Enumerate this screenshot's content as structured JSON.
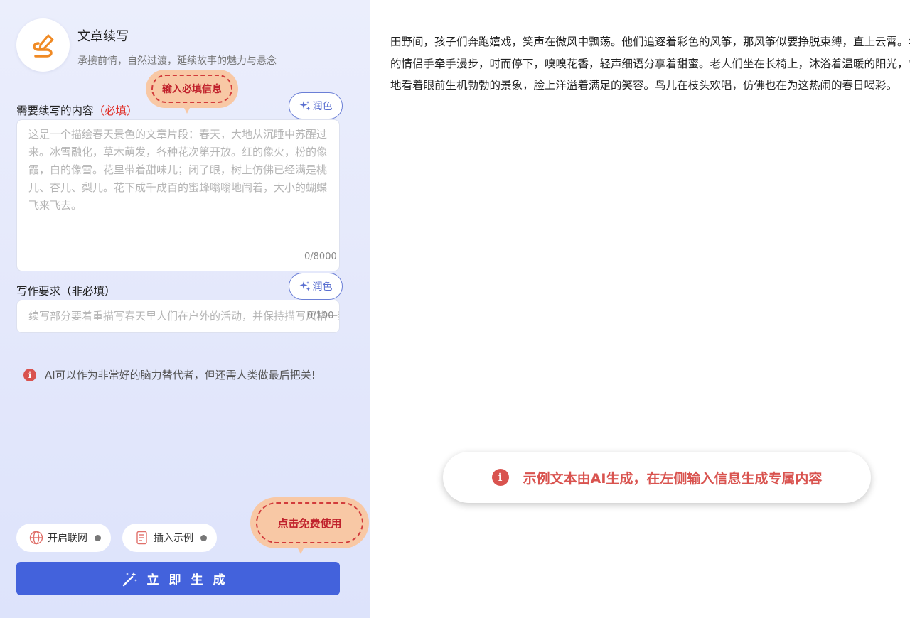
{
  "header": {
    "title": "文章续写",
    "subtitle": "承接前情，自然过渡，延续故事的魅力与悬念"
  },
  "content_field": {
    "label": "需要续写的内容",
    "required_tag": "（必填）",
    "placeholder": "这是一个描绘春天景色的文章片段：春天，大地从沉睡中苏醒过来。冰雪融化，草木萌发，各种花次第开放。红的像火，粉的像霞，白的像雪。花里带着甜味儿；闭了眼，树上仿佛已经满是桃儿、杏儿、梨儿。花下成千成百的蜜蜂嗡嗡地闹着，大小的蝴蝶飞来飞去。",
    "counter": "0/8000",
    "polish_label": "润色"
  },
  "requirement_field": {
    "label": "写作要求（非必填）",
    "placeholder": "续写部分要着重描写春天里人们在户外的活动，并保持描写风格一致",
    "counter": "0/100",
    "polish_label": "润色"
  },
  "tip": "AI可以作为非常好的脑力替代者，但还需人类做最后把关!",
  "callouts": {
    "fill_required": "输入必填信息",
    "free_use": "点击免费使用"
  },
  "chips": {
    "web": "开启联网",
    "example": "插入示例"
  },
  "generate_label": "立即生成",
  "sample_output": "田野间，孩子们奔跑嬉戏，笑声在微风中飘荡。他们追逐着彩色的风筝，那风筝似要挣脱束缚，直上云霄。年轻的情侣手牵手漫步，时而停下，嗅嗅花香，轻声细语分享着甜蜜。老人们坐在长椅上，沐浴着温暖的阳光，惬意地看着眼前生机勃勃的景象，脸上洋溢着满足的笑容。鸟儿在枝头欢唱，仿佛也在为这热闹的春日喝彩。",
  "notice": "示例文本由AI生成，在左侧输入信息生成专属内容",
  "colors": {
    "accent": "#4362dc",
    "required": "#e0312a",
    "notice": "#d9534f",
    "callout_bg": "#f8c8a5"
  },
  "icons": [
    "pen-logo-icon",
    "sparkle-icon",
    "info-icon",
    "globe-icon",
    "document-icon",
    "magic-wand-icon"
  ]
}
